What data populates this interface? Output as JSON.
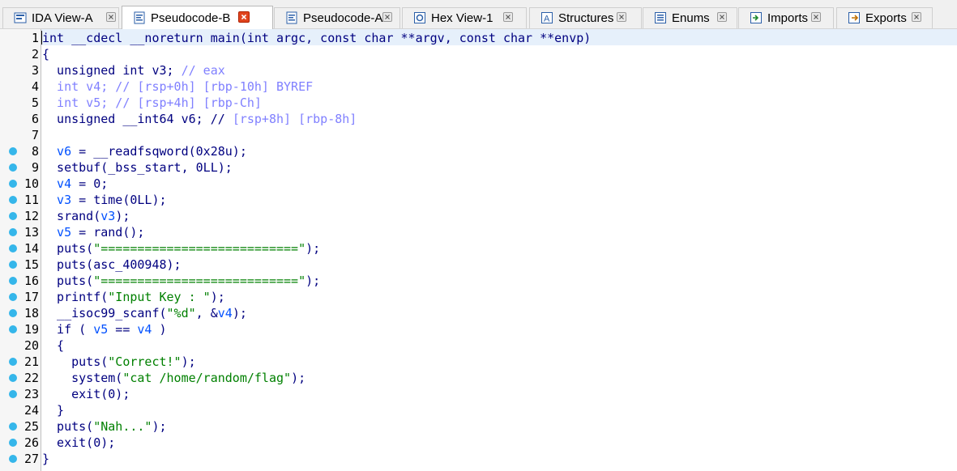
{
  "tabs": [
    {
      "label": "IDA View-A",
      "icon": "ida-view-icon",
      "active": false
    },
    {
      "label": "Pseudocode-B",
      "icon": "pseudocode-icon",
      "active": true
    },
    {
      "label": "Pseudocode-A",
      "icon": "pseudocode-icon",
      "active": false
    },
    {
      "label": "Hex View-1",
      "icon": "hex-view-icon",
      "active": false
    },
    {
      "label": "Structures",
      "icon": "structures-icon",
      "active": false
    },
    {
      "label": "Enums",
      "icon": "enums-icon",
      "active": false
    },
    {
      "label": "Imports",
      "icon": "imports-icon",
      "active": false
    },
    {
      "label": "Exports",
      "icon": "exports-icon",
      "active": false
    }
  ],
  "colors": {
    "keyword": "#000080",
    "variable": "#0050ff",
    "string": "#008000",
    "comment": "#8080ff",
    "breakpoint_dot": "#35b6ea",
    "current_line": "#e6f0fb",
    "active_close": "#e0441e"
  },
  "code": {
    "lines": [
      {
        "num": "1",
        "dot": false,
        "tokens": [
          [
            "kw",
            "int __cdecl __noreturn main(int argc, const char **argv, const char **envp)"
          ]
        ]
      },
      {
        "num": "2",
        "dot": false,
        "tokens": [
          [
            "kw",
            "{"
          ]
        ]
      },
      {
        "num": "3",
        "dot": false,
        "tokens": [
          [
            "kw",
            "  unsigned int v3; "
          ],
          [
            "cmt",
            "// eax"
          ]
        ]
      },
      {
        "num": "4",
        "dot": false,
        "tokens": [
          [
            "cmt",
            "  int v4; // [rsp+0h] [rbp-10h] BYREF"
          ]
        ]
      },
      {
        "num": "5",
        "dot": false,
        "tokens": [
          [
            "cmt",
            "  int v5; // [rsp+4h] [rbp-Ch]"
          ]
        ]
      },
      {
        "num": "6",
        "dot": false,
        "tokens": [
          [
            "kw",
            "  unsigned __int64 v6; // "
          ],
          [
            "cmt",
            "[rsp+8h] [rbp-8h]"
          ]
        ]
      },
      {
        "num": "7",
        "dot": false,
        "tokens": [
          [
            "kw",
            ""
          ]
        ]
      },
      {
        "num": "8",
        "dot": true,
        "tokens": [
          [
            "var",
            "  v6"
          ],
          [
            "kw",
            " = __readfsqword(0x28u);"
          ]
        ]
      },
      {
        "num": "9",
        "dot": true,
        "tokens": [
          [
            "kw",
            "  setbuf(_bss_start, 0LL);"
          ]
        ]
      },
      {
        "num": "10",
        "dot": true,
        "tokens": [
          [
            "var",
            "  v4"
          ],
          [
            "kw",
            " = 0;"
          ]
        ]
      },
      {
        "num": "11",
        "dot": true,
        "tokens": [
          [
            "var",
            "  v3"
          ],
          [
            "kw",
            " = time(0LL);"
          ]
        ]
      },
      {
        "num": "12",
        "dot": true,
        "tokens": [
          [
            "kw",
            "  srand("
          ],
          [
            "var",
            "v3"
          ],
          [
            "kw",
            ");"
          ]
        ]
      },
      {
        "num": "13",
        "dot": true,
        "tokens": [
          [
            "var",
            "  v5"
          ],
          [
            "kw",
            " = rand();"
          ]
        ]
      },
      {
        "num": "14",
        "dot": true,
        "tokens": [
          [
            "kw",
            "  puts("
          ],
          [
            "str",
            "\"===========================\""
          ],
          [
            "kw",
            ");"
          ]
        ]
      },
      {
        "num": "15",
        "dot": true,
        "tokens": [
          [
            "kw",
            "  puts(asc_400948);"
          ]
        ]
      },
      {
        "num": "16",
        "dot": true,
        "tokens": [
          [
            "kw",
            "  puts("
          ],
          [
            "str",
            "\"===========================\""
          ],
          [
            "kw",
            ");"
          ]
        ]
      },
      {
        "num": "17",
        "dot": true,
        "tokens": [
          [
            "kw",
            "  printf("
          ],
          [
            "str",
            "\"Input Key : \""
          ],
          [
            "kw",
            ");"
          ]
        ]
      },
      {
        "num": "18",
        "dot": true,
        "tokens": [
          [
            "kw",
            "  __isoc99_scanf("
          ],
          [
            "str",
            "\"%d\""
          ],
          [
            "kw",
            ", &"
          ],
          [
            "var",
            "v4"
          ],
          [
            "kw",
            ");"
          ]
        ]
      },
      {
        "num": "19",
        "dot": true,
        "tokens": [
          [
            "kw",
            "  if ( "
          ],
          [
            "var",
            "v5"
          ],
          [
            "kw",
            " == "
          ],
          [
            "var",
            "v4"
          ],
          [
            "kw",
            " )"
          ]
        ]
      },
      {
        "num": "20",
        "dot": false,
        "tokens": [
          [
            "kw",
            "  {"
          ]
        ]
      },
      {
        "num": "21",
        "dot": true,
        "tokens": [
          [
            "kw",
            "    puts("
          ],
          [
            "str",
            "\"Correct!\""
          ],
          [
            "kw",
            ");"
          ]
        ]
      },
      {
        "num": "22",
        "dot": true,
        "tokens": [
          [
            "kw",
            "    system("
          ],
          [
            "str",
            "\"cat /home/random/flag\""
          ],
          [
            "kw",
            ");"
          ]
        ]
      },
      {
        "num": "23",
        "dot": true,
        "tokens": [
          [
            "kw",
            "    exit(0);"
          ]
        ]
      },
      {
        "num": "24",
        "dot": false,
        "tokens": [
          [
            "kw",
            "  }"
          ]
        ]
      },
      {
        "num": "25",
        "dot": true,
        "tokens": [
          [
            "kw",
            "  puts("
          ],
          [
            "str",
            "\"Nah...\""
          ],
          [
            "kw",
            ");"
          ]
        ]
      },
      {
        "num": "26",
        "dot": true,
        "tokens": [
          [
            "kw",
            "  exit(0);"
          ]
        ]
      },
      {
        "num": "27",
        "dot": true,
        "tokens": [
          [
            "kw",
            "}"
          ]
        ]
      }
    ]
  }
}
